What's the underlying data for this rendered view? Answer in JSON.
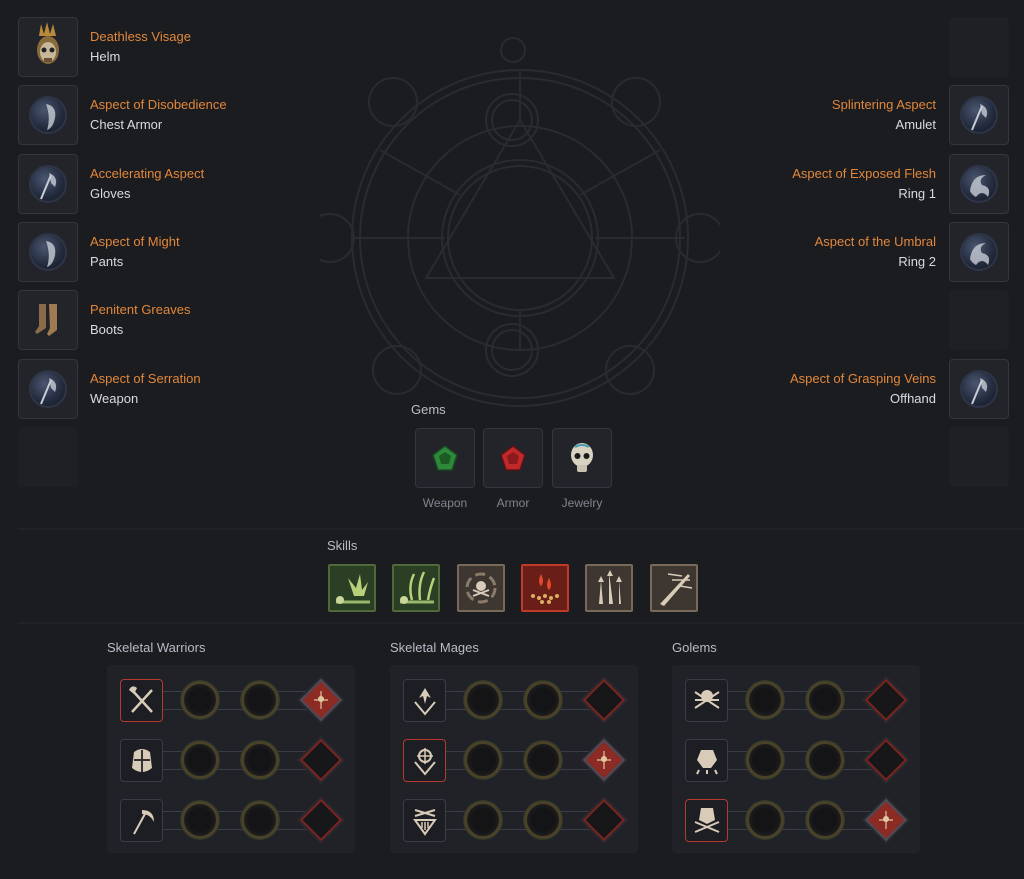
{
  "equipment": {
    "left": [
      {
        "name": "Deathless Visage",
        "slot": "Helm",
        "icon": "helm-icon"
      },
      {
        "name": "Aspect of Disobedience",
        "slot": "Chest Armor",
        "icon": "aspect-orb-icon"
      },
      {
        "name": "Accelerating Aspect",
        "slot": "Gloves",
        "icon": "aspect-orb-axe-icon"
      },
      {
        "name": "Aspect of Might",
        "slot": "Pants",
        "icon": "aspect-orb-icon"
      },
      {
        "name": "Penitent Greaves",
        "slot": "Boots",
        "icon": "boots-icon"
      },
      {
        "name": "Aspect of Serration",
        "slot": "Weapon",
        "icon": "aspect-orb-axe-icon"
      }
    ],
    "right": [
      {
        "name": "Splintering Aspect",
        "slot": "Amulet",
        "icon": "aspect-orb-axe-icon"
      },
      {
        "name": "Aspect of Exposed Flesh",
        "slot": "Ring 1",
        "icon": "aspect-orb-flame-icon"
      },
      {
        "name": "Aspect of the Umbral",
        "slot": "Ring 2",
        "icon": "aspect-orb-flame-icon"
      },
      {
        "name": "Aspect of Grasping Veins",
        "slot": "Offhand",
        "icon": "aspect-orb-axe-icon"
      }
    ]
  },
  "gems": {
    "label": "Gems",
    "items": [
      {
        "caption": "Weapon",
        "icon": "emerald-gem-icon",
        "color": "#2e8a3a"
      },
      {
        "caption": "Armor",
        "icon": "ruby-gem-icon",
        "color": "#c0282a"
      },
      {
        "caption": "Jewelry",
        "icon": "skull-gem-icon",
        "color": "#d8d2c0"
      }
    ]
  },
  "skills": {
    "label": "Skills",
    "items": [
      {
        "icon": "corpse-explosion-icon",
        "border": "#4e6a3a",
        "bg": "#2a3f24"
      },
      {
        "icon": "corpse-tendrils-icon",
        "border": "#4e6a3a",
        "bg": "#2a3f24"
      },
      {
        "icon": "skull-vortex-icon",
        "border": "#7a6858",
        "bg": "#3e3630"
      },
      {
        "icon": "blood-mist-icon",
        "border": "#c03a2a",
        "bg": "#6a1e18"
      },
      {
        "icon": "bone-spikes-icon",
        "border": "#7a6858",
        "bg": "#3e3630"
      },
      {
        "icon": "bone-spear-icon",
        "border": "#7a6858",
        "bg": "#3e3630"
      }
    ]
  },
  "minions": [
    {
      "label": "Skeletal Warriors",
      "rows": [
        {
          "icon": "crossed-axe-sword-icon",
          "active": true,
          "upgrade_active": true
        },
        {
          "icon": "bone-shield-icon",
          "active": false,
          "upgrade_active": false
        },
        {
          "icon": "scythe-icon",
          "active": false,
          "upgrade_active": false
        }
      ]
    },
    {
      "label": "Skeletal Mages",
      "rows": [
        {
          "icon": "shadow-mage-icon",
          "active": false,
          "upgrade_active": false
        },
        {
          "icon": "cold-mage-icon",
          "active": true,
          "upgrade_active": true
        },
        {
          "icon": "bone-mage-icon",
          "active": false,
          "upgrade_active": false
        }
      ]
    },
    {
      "label": "Golems",
      "rows": [
        {
          "icon": "bone-golem-icon",
          "active": false,
          "upgrade_active": false
        },
        {
          "icon": "blood-golem-icon",
          "active": false,
          "upgrade_active": false
        },
        {
          "icon": "iron-golem-icon",
          "active": true,
          "upgrade_active": true
        }
      ]
    }
  ],
  "colors": {
    "item_name": "#e2873a",
    "background": "#1b1c20",
    "active_border": "#b53a2e"
  }
}
